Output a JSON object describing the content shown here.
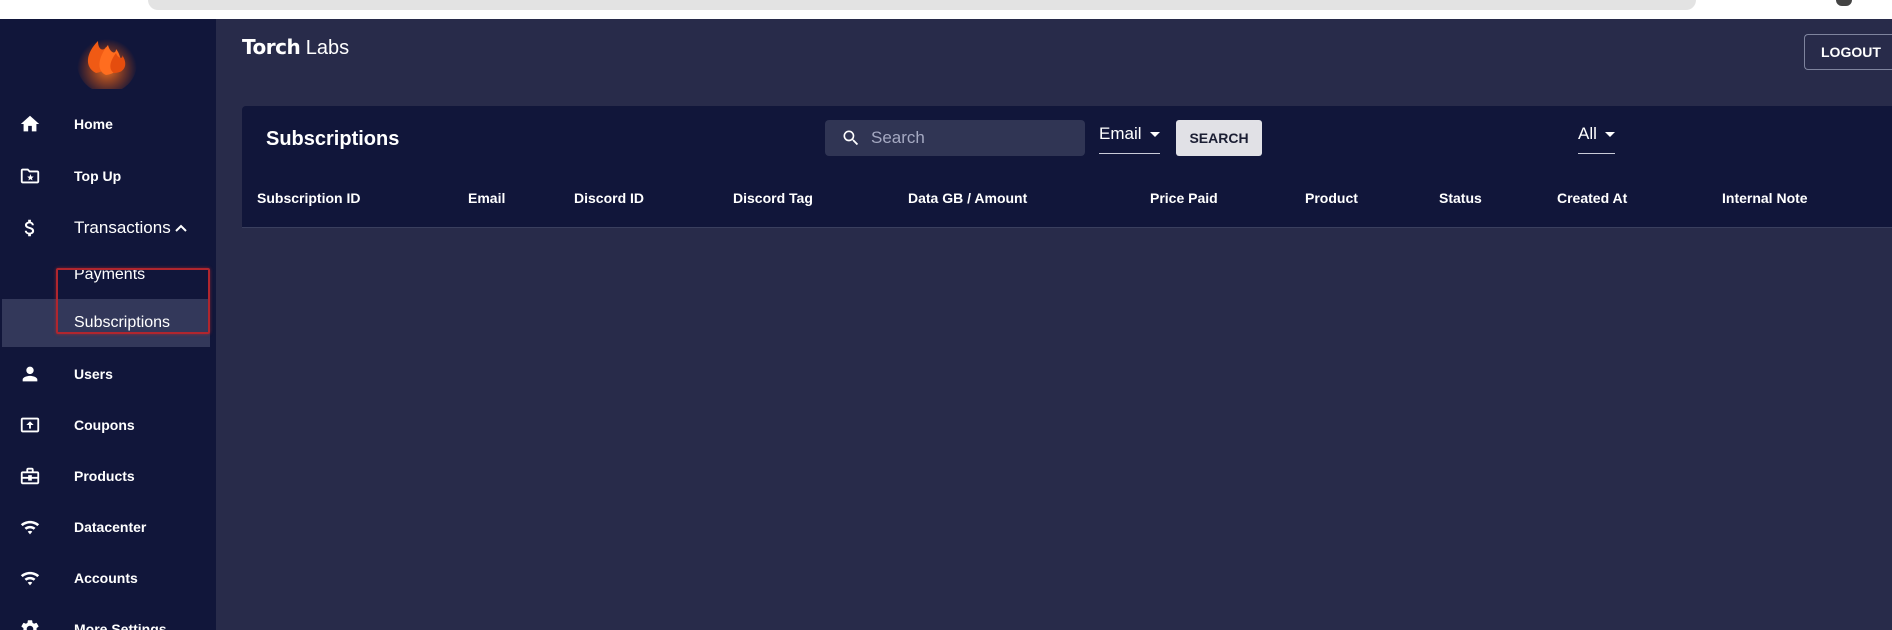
{
  "app": {
    "title_bold": "Torch",
    "title_rest": "Labs",
    "logout_label": "LOGOUT"
  },
  "sidebar": {
    "items": [
      {
        "label": "Home",
        "icon": "home-icon"
      },
      {
        "label": "Top Up",
        "icon": "folder-star-icon"
      },
      {
        "label": "Transactions",
        "icon": "dollar-icon",
        "expanded": true
      },
      {
        "label": "Payments"
      },
      {
        "label": "Subscriptions",
        "active": true
      },
      {
        "label": "Users",
        "icon": "person-icon"
      },
      {
        "label": "Coupons",
        "icon": "upload-box-icon"
      },
      {
        "label": "Products",
        "icon": "briefcase-icon"
      },
      {
        "label": "Datacenter",
        "icon": "wifi-icon"
      },
      {
        "label": "Accounts",
        "icon": "wifi-icon"
      },
      {
        "label": "More Settings",
        "icon": "gear-icon"
      }
    ]
  },
  "panel": {
    "title": "Subscriptions",
    "search_placeholder": "Search",
    "search_field_select": "Email",
    "search_button": "SEARCH",
    "status_select": "All",
    "columns": [
      "Subscription ID",
      "Email",
      "Discord ID",
      "Discord Tag",
      "Data GB / Amount",
      "Price Paid",
      "Product",
      "Status",
      "Created At",
      "Internal Note"
    ]
  },
  "colors": {
    "sidebar_bg": "#11163a",
    "page_bg": "#282b4a",
    "accent": "#f26419",
    "highlight": "#b0262e"
  }
}
